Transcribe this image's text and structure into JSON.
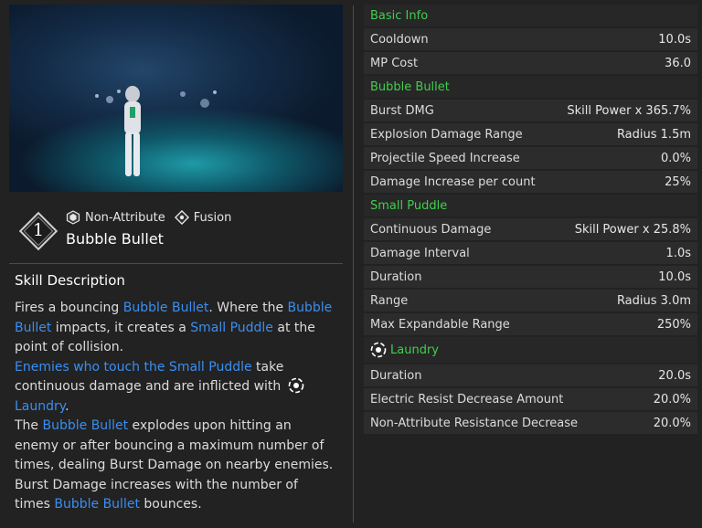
{
  "skill": {
    "number": "1",
    "attributes": [
      {
        "label": "Non-Attribute",
        "icon": "non-attribute-icon"
      },
      {
        "label": "Fusion",
        "icon": "fusion-icon"
      }
    ],
    "name": "Bubble Bullet"
  },
  "description": {
    "title": "Skill Description",
    "p1_a": "Fires a bouncing ",
    "p1_hl1": "Bubble Bullet",
    "p1_b": ". Where the ",
    "p1_hl2": "Bubble Bullet",
    "p1_c": " impacts, it creates a ",
    "p1_hl3": "Small Puddle",
    "p1_d": " at the point of collision.",
    "p2_hl1": "Enemies who touch the Small Puddle",
    "p2_a": " take continuous damage and are inflicted with ",
    "p2_hl2": "Laundry",
    "p2_b": ".",
    "p3_a": "The ",
    "p3_hl1": "Bubble Bullet",
    "p3_b": " explodes upon hitting an enemy or after bouncing a maximum number of times, dealing Burst Damage on nearby enemies.",
    "p4_a": "Burst Damage increases with the number of times ",
    "p4_hl1": "Bubble Bullet",
    "p4_b": " bounces."
  },
  "stats": {
    "basic_info": {
      "title": "Basic Info",
      "rows": [
        {
          "label": "Cooldown",
          "value": "10.0s"
        },
        {
          "label": "MP Cost",
          "value": "36.0"
        }
      ]
    },
    "bubble_bullet": {
      "title": "Bubble Bullet",
      "rows": [
        {
          "label": "Burst DMG",
          "value": "Skill Power x 365.7%"
        },
        {
          "label": "Explosion Damage Range",
          "value": "Radius 1.5m"
        },
        {
          "label": "Projectile Speed Increase",
          "value": "0.0%"
        },
        {
          "label": "Damage Increase per count",
          "value": "25%"
        }
      ]
    },
    "small_puddle": {
      "title": "Small Puddle",
      "rows": [
        {
          "label": "Continuous Damage",
          "value": "Skill Power x 25.8%"
        },
        {
          "label": "Damage Interval",
          "value": "1.0s"
        },
        {
          "label": "Duration",
          "value": "10.0s"
        },
        {
          "label": "Range",
          "value": "Radius 3.0m"
        },
        {
          "label": "Max Expandable Range",
          "value": "250%"
        }
      ]
    },
    "laundry": {
      "title": "Laundry",
      "icon": "laundry-icon",
      "rows": [
        {
          "label": "Duration",
          "value": "20.0s"
        },
        {
          "label": "Electric Resist Decrease Amount",
          "value": "20.0%"
        },
        {
          "label": "Non-Attribute Resistance Decrease",
          "value": "20.0%"
        }
      ]
    }
  },
  "colors": {
    "background": "#222222",
    "row_bg": "#2c2c2c",
    "section_green": "#3fcf4d",
    "highlight_blue": "#3b8ef0"
  }
}
